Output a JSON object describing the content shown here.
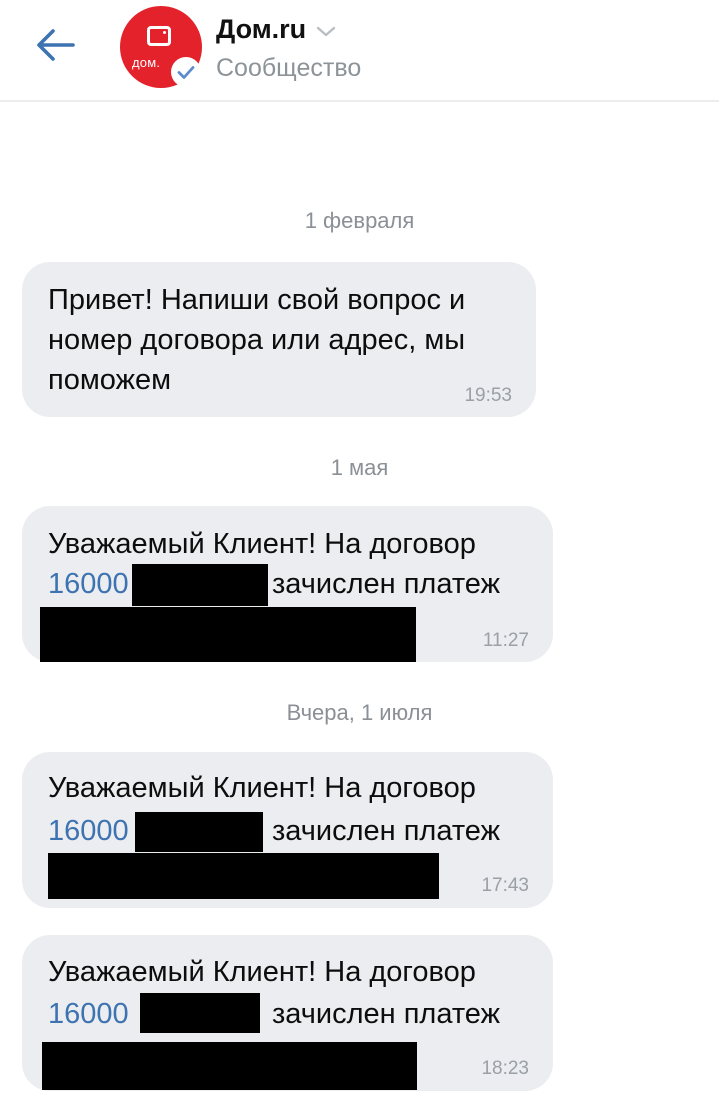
{
  "header": {
    "title": "Дом.ru",
    "subtitle": "Сообщество",
    "avatar_text": "дом.",
    "back_icon": "arrow-left-icon",
    "verified_icon": "check-badge-icon",
    "chevron_icon": "chevron-down-icon"
  },
  "colors": {
    "accent": "#3d73b0",
    "brand": "#e3222b",
    "bubble": "#ebedf0",
    "secondary_text": "#8a9096",
    "redaction": "#000000"
  },
  "chat": {
    "dates": [
      "1 февраля",
      "1 мая",
      "Вчера, 1 июля"
    ],
    "messages": [
      {
        "lines": [
          "Привет! Напиши свой вопрос и",
          "номер договора или адрес, мы",
          "поможем"
        ],
        "time": "19:53"
      },
      {
        "line1": "Уважаемый Клиент! На договор",
        "contract": "16000",
        "paid": "зачислен платеж",
        "time": "11:27"
      },
      {
        "line1": "Уважаемый Клиент! На договор",
        "contract": "16000",
        "paid": "зачислен платеж",
        "time": "17:43"
      },
      {
        "line1": "Уважаемый Клиент! На договор",
        "contract": "16000",
        "paid": "зачислен платеж",
        "time": "18:23"
      }
    ]
  }
}
